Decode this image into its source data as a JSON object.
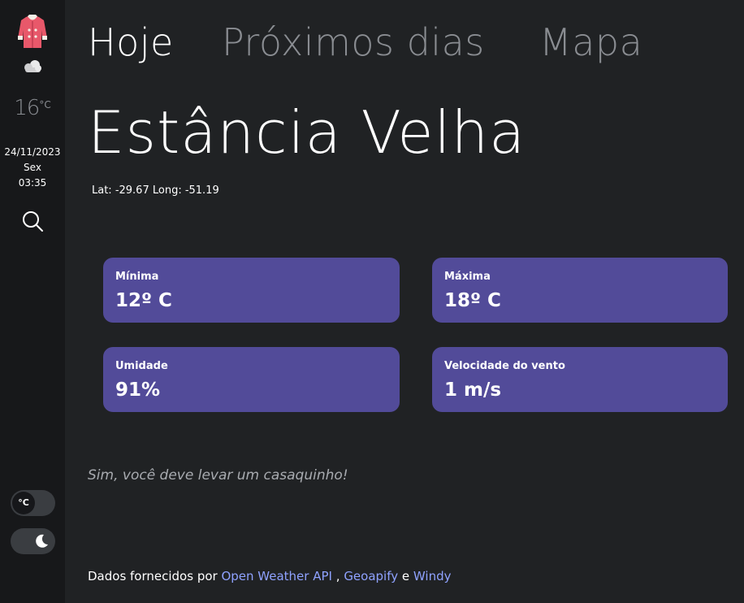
{
  "sidebar": {
    "temp_value": "16",
    "temp_unit": "°C",
    "date": "24/11/2023",
    "weekday": "Sex",
    "time": "03:35",
    "unit_toggle_label": "°C",
    "icons": [
      "jacket-icon",
      "cloud-icon",
      "search-icon",
      "moon-icon"
    ]
  },
  "tabs": [
    {
      "label": "Hoje",
      "active": true
    },
    {
      "label": "Próximos dias",
      "active": false
    },
    {
      "label": "Mapa",
      "active": false
    }
  ],
  "location": {
    "city": "Estância Velha",
    "coords": "Lat: -29.67 Long: -51.19"
  },
  "cards": {
    "min": {
      "label": "Mínima",
      "value": "12º C"
    },
    "max": {
      "label": "Máxima",
      "value": "18º C"
    },
    "humidity": {
      "label": "Umidade",
      "value": "91%"
    },
    "wind": {
      "label": "Velocidade do vento",
      "value": "1 m/s"
    }
  },
  "advice": "Sim, você deve levar um casaquinho!",
  "footer": {
    "prefix": "Dados fornecidos por",
    "link1": "Open Weather API",
    "sep1": ",",
    "link2": "Geoapify",
    "sep2": "e",
    "link3": "Windy"
  },
  "colors": {
    "background": "#202224",
    "sidebar": "#17181a",
    "card": "#524b99",
    "link": "#8fa2ff",
    "jacket": "#e8586a"
  }
}
